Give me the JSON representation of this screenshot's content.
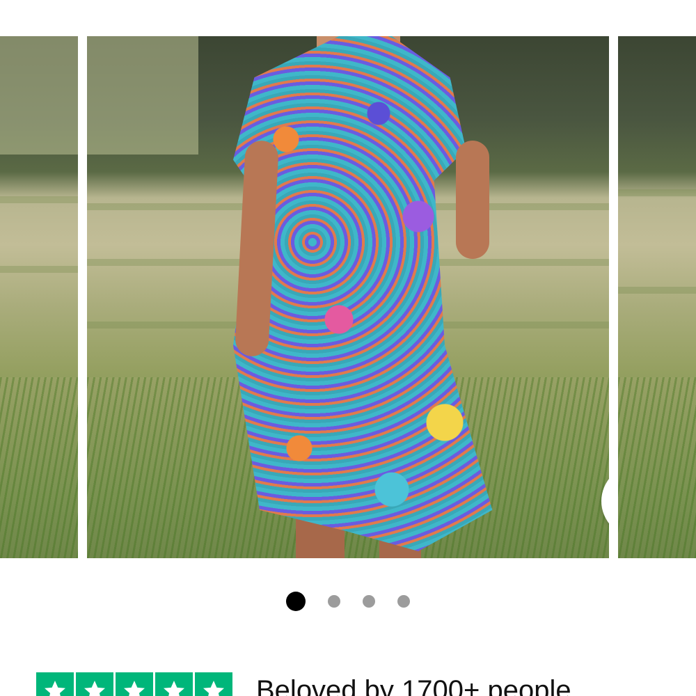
{
  "carousel": {
    "slides": [
      {
        "role": "previous"
      },
      {
        "role": "current",
        "description_icon": "product-photo"
      },
      {
        "role": "next"
      }
    ],
    "zoom_icon": "search-icon",
    "dots": {
      "count": 4,
      "active_index": 0
    }
  },
  "trust_bar": {
    "star_count": 5,
    "star_color": "#00b67a",
    "text": "Beloved by 1700+ people"
  }
}
